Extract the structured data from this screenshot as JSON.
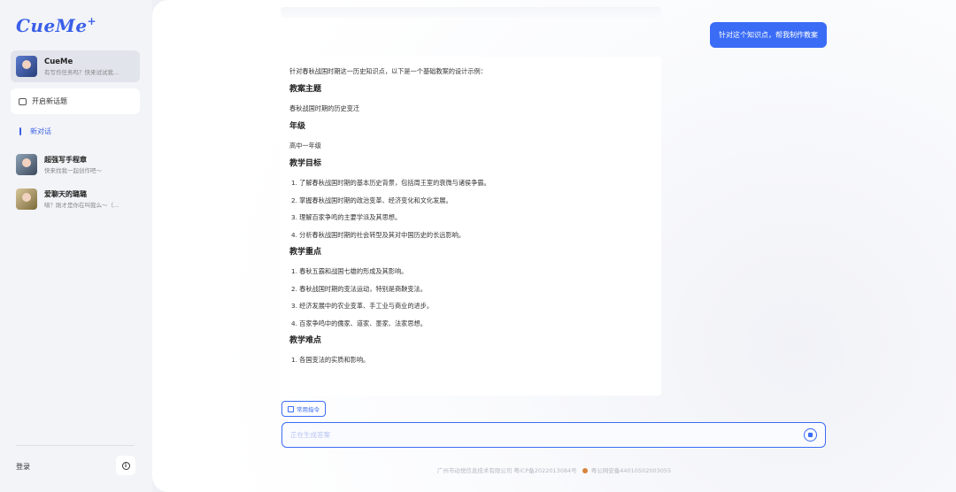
{
  "sidebar": {
    "logo": "CueMe",
    "logo_plus": "+",
    "current_agent": {
      "name": "CueMe",
      "subtitle": "有写作任务吗？快来试试我..."
    },
    "new_topic_label": "开启新话题",
    "new_chat_label": "新对话",
    "history": [
      {
        "name": "超强写手程章",
        "subtitle": "快来找我一起创作吧～"
      },
      {
        "name": "爱聊天的璐璐",
        "subtitle": "嗔？刚才是你在叫我么～（..."
      }
    ],
    "login_label": "登录",
    "info_icon": "i"
  },
  "chat": {
    "user_message": "针对这个知识点，帮我制作教案",
    "answer": {
      "intro": "针对春秋战国时期这一历史知识点，以下是一个基础教案的设计示例：",
      "sections": [
        {
          "heading": "教案主题",
          "text": "春秋战国时期的历史变迁"
        },
        {
          "heading": "年级",
          "text": "高中一年级"
        },
        {
          "heading": "教学目标",
          "items": [
            "1. 了解春秋战国时期的基本历史背景，包括周王室的衰微与诸侯争霸。",
            "2. 掌握春秋战国时期的政治变革、经济变化和文化发展。",
            "3. 理解百家争鸣的主要学派及其思想。",
            "4. 分析春秋战国时期的社会转型及其对中国历史的长远影响。"
          ]
        },
        {
          "heading": "教学重点",
          "items": [
            "1. 春秋五霸和战国七雄的形成及其影响。",
            "2. 春秋战国时期的变法运动，特别是商鞅变法。",
            "3. 经济发展中的农业变革、手工业与商业的进步。",
            "4. 百家争鸣中的儒家、道家、墨家、法家思想。"
          ]
        },
        {
          "heading": "教学难点",
          "items": [
            "1. 各国变法的实质和影响。"
          ]
        }
      ]
    },
    "common_commands_label": "常用指令",
    "input_placeholder": "正在生成答案",
    "footer_company": "广州市动悦信息技术有限公司 粤ICP备2022013084号",
    "footer_police": "粤公网安备44010502003055"
  },
  "colors": {
    "accent": "#3a6cf6",
    "logo": "#3a5fe8"
  }
}
